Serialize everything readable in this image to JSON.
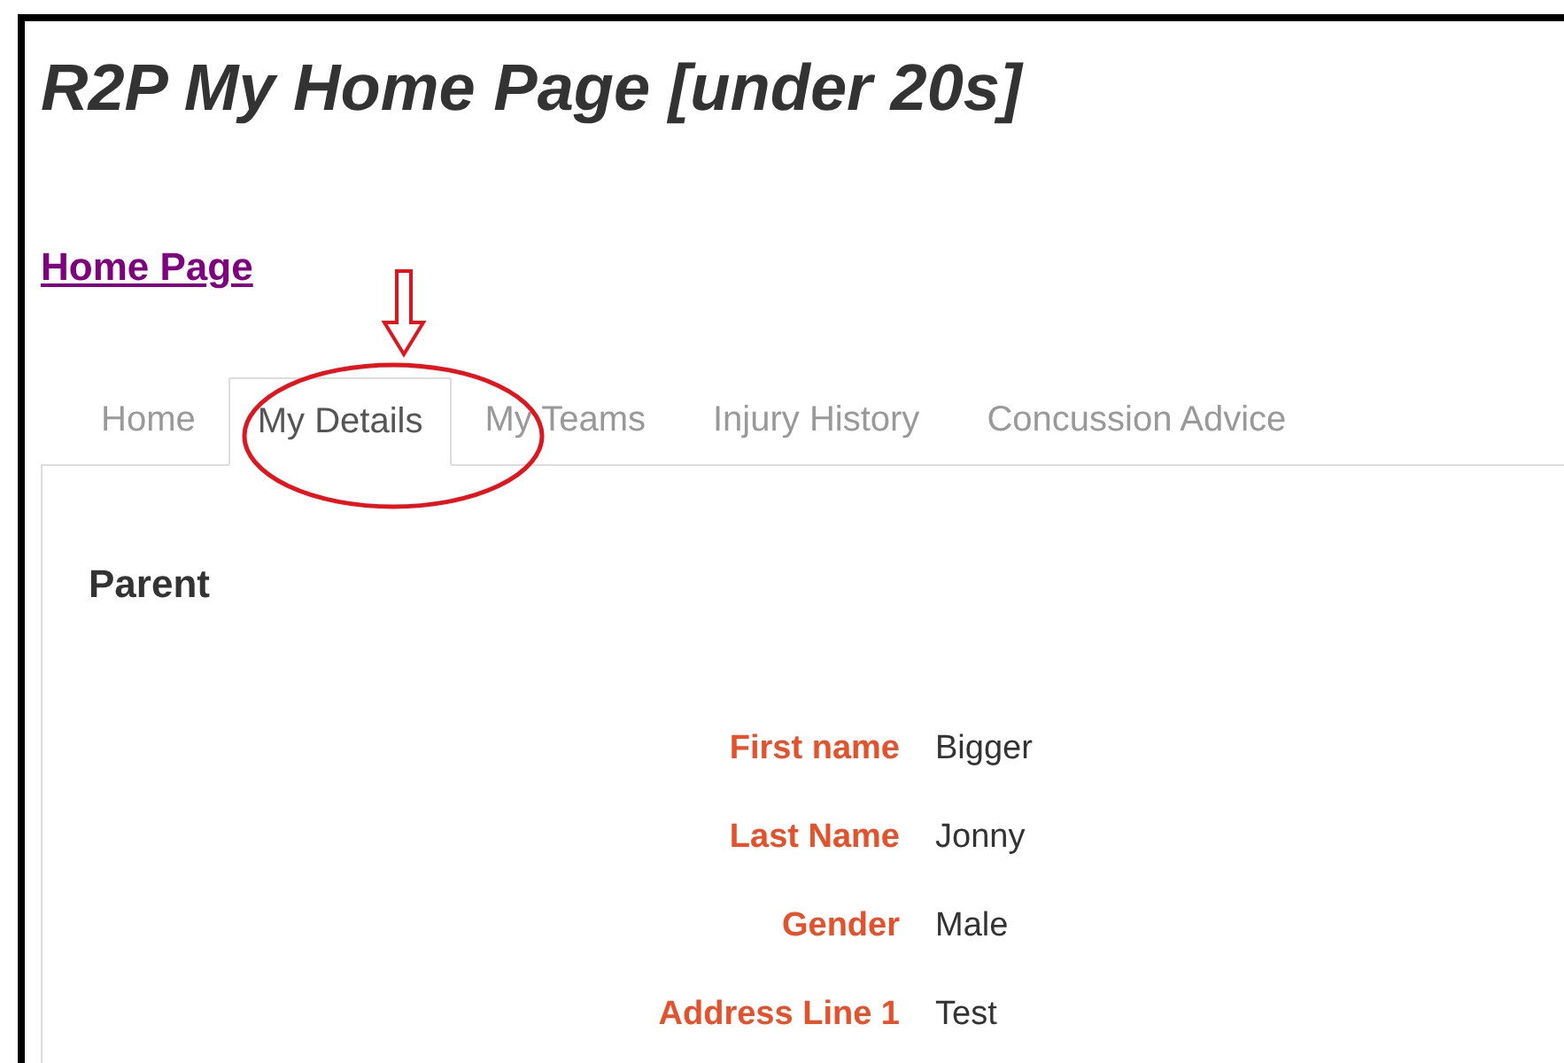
{
  "page_title": "R2P My Home Page [under 20s]",
  "home_link": "Home Page",
  "tabs": [
    {
      "label": "Home",
      "selected": false
    },
    {
      "label": "My Details",
      "selected": true
    },
    {
      "label": "My Teams",
      "selected": false
    },
    {
      "label": "Injury History",
      "selected": false
    },
    {
      "label": "Concussion Advice",
      "selected": false
    }
  ],
  "section_title": "Parent",
  "fields": [
    {
      "label": "First name",
      "value": "Bigger"
    },
    {
      "label": "Last Name",
      "value": "Jonny"
    },
    {
      "label": "Gender",
      "value": "Male"
    },
    {
      "label": "Address Line 1",
      "value": "Test"
    }
  ]
}
